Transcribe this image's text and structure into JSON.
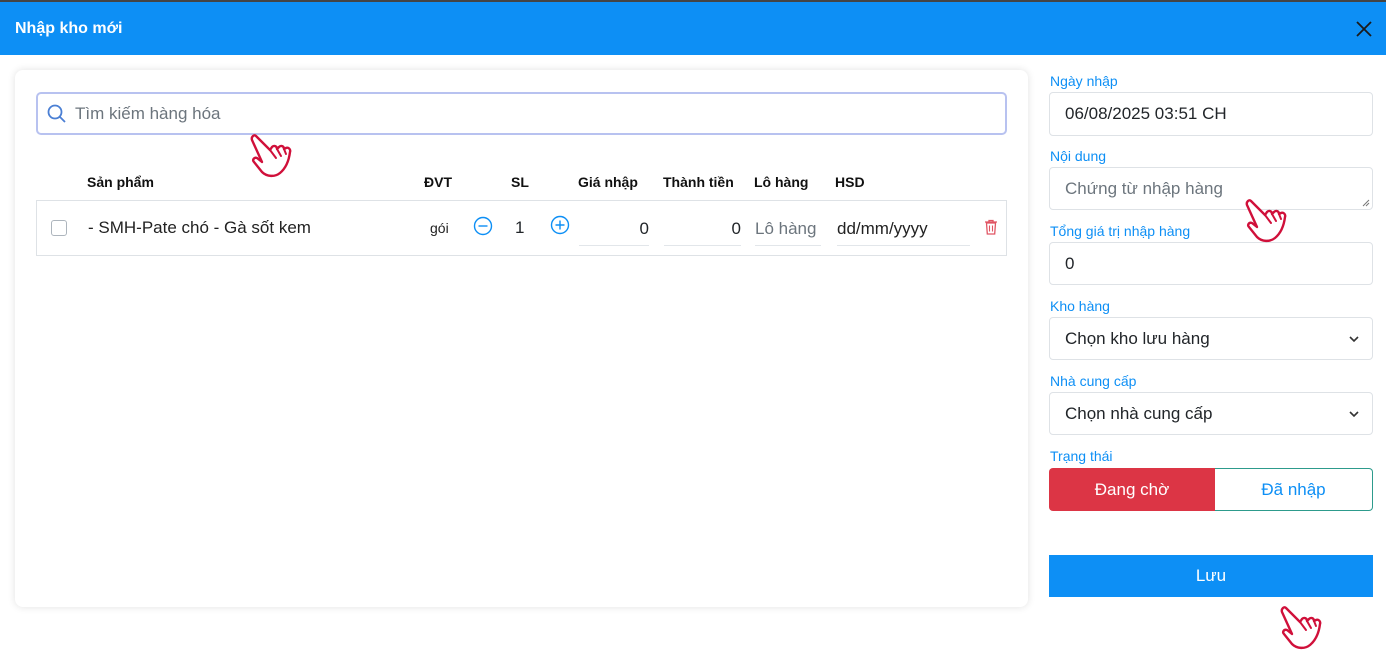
{
  "modal": {
    "title": "Nhập kho mới",
    "close_icon": "close-icon"
  },
  "search": {
    "placeholder": "Tìm kiếm hàng hóa",
    "icon": "search-icon"
  },
  "table": {
    "headers": {
      "product": "Sản phẩm",
      "unit": "ĐVT",
      "qty": "SL",
      "price": "Giá nhập",
      "total": "Thành tiền",
      "lot": "Lô hàng",
      "expiry": "HSD"
    },
    "rows": [
      {
        "product": "- SMH-Pate chó - Gà sốt kem",
        "unit": "gói",
        "qty": "1",
        "price": "0",
        "total": "0",
        "lot_placeholder": "Lô hàng",
        "expiry": "dd/mm/yyyy"
      }
    ]
  },
  "form": {
    "date_label": "Ngày nhập",
    "date_value": "06/08/2025 03:51  CH",
    "content_label": "Nội dung",
    "content_placeholder": "Chứng từ nhập hàng",
    "total_label": "Tổng giá trị nhập hàng",
    "total_value": "0",
    "warehouse_label": "Kho hàng",
    "warehouse_value": "Chọn kho lưu hàng",
    "supplier_label": "Nhà cung cấp",
    "supplier_value": "Chọn nhà cung cấp",
    "status_label": "Trạng thái",
    "status_pending": "Đang chờ",
    "status_done": "Đã nhập",
    "save_label": "Lưu"
  },
  "colors": {
    "primary": "#0d8ff5",
    "danger": "#dc3545",
    "hand": "#d0103a"
  }
}
